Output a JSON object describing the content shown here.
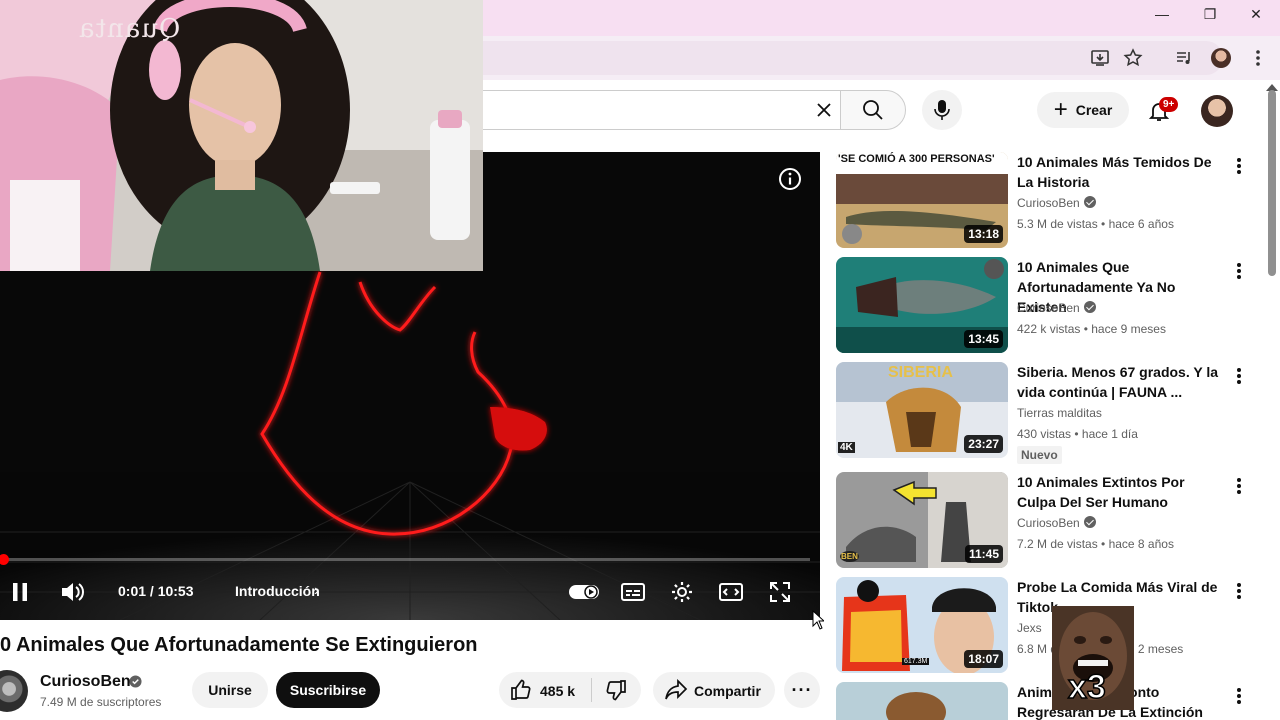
{
  "browser": {
    "window_controls": {
      "minimize": "—",
      "restore": "❐",
      "close": "✕"
    },
    "toolbar_icons": [
      "install-icon",
      "bookmark-star-icon",
      "media-control-icon",
      "profile-avatar-icon",
      "browser-menu-icon"
    ]
  },
  "webcam": {
    "chair_text": "Quanta"
  },
  "masthead": {
    "create_label": "Crear",
    "notifications_badge": "9+"
  },
  "player": {
    "time": "0:01 / 10:53",
    "chapter": "Introducción",
    "progress_fraction": 0.0015,
    "accent_color": "#ff0000"
  },
  "video": {
    "title": "0 Animales Que Afortunadamente Se Extinguieron",
    "channel": "CuriosoBen",
    "subscribers": "7.49 M de suscriptores",
    "join_label": "Unirse",
    "subscribe_label": "Suscribirse",
    "likes": "485 k",
    "share_label": "Compartir"
  },
  "recommendations": [
    {
      "title": "10 Animales Más Temidos De La Historia",
      "channel": "CuriosoBen",
      "verified": true,
      "meta": "5.3 M de vistas • hace 6 años",
      "duration": "13:18",
      "thumb_text": "'SE COMIÓ A 300 PERSONAS'"
    },
    {
      "title": "10 Animales Que Afortunadamente Ya No Existen",
      "channel": "CuriosoBen",
      "verified": true,
      "meta": "422 k vistas • hace 9 meses",
      "duration": "13:45"
    },
    {
      "title": "Siberia. Menos 67 grados. Y la vida continúa | FAUNA ...",
      "channel": "Tierras malditas",
      "verified": false,
      "meta": "430 vistas • hace 1 día",
      "badge": "Nuevo",
      "duration": "23:27",
      "thumb_text": "SIBERIA",
      "thumb_tag": "4K"
    },
    {
      "title": "10 Animales Extintos Por Culpa Del Ser Humano",
      "channel": "CuriosoBen",
      "verified": true,
      "meta": "7.2 M de vistas • hace 8 años",
      "duration": "11:45",
      "thumb_tag": "BEN"
    },
    {
      "title": "Probe La Comida Más Viral de Tiktok",
      "channel": "Jexs",
      "verified": false,
      "meta": "6.8 M de vistas • hace 2 meses",
      "duration": "18:07",
      "thumb_tag": "617.3M"
    },
    {
      "title": "Animales Que Pronto Regresarán De La Extinción",
      "channel": "",
      "verified": false,
      "meta": "",
      "duration": ""
    }
  ],
  "meme_overlay": {
    "text": "x3"
  }
}
